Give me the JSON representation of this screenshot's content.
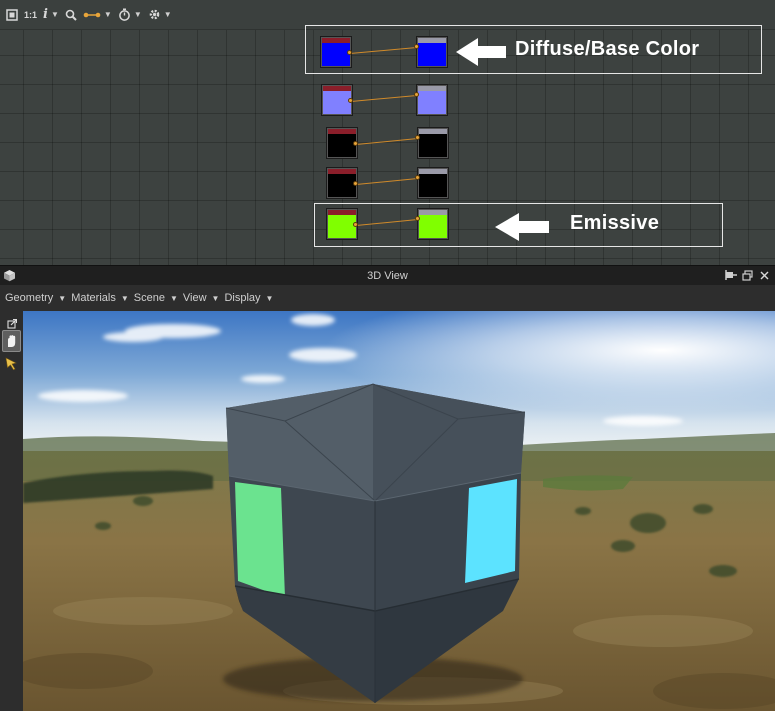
{
  "node_editor": {
    "toolbar": [
      {
        "name": "fit-view-icon",
        "glyph": "▦",
        "dropdown": false
      },
      {
        "name": "one-to-one",
        "label": "1:1",
        "dropdown": false
      },
      {
        "name": "info-icon",
        "label": "i",
        "dropdown": true
      },
      {
        "name": "zoom-icon",
        "glyph": "🔍",
        "dropdown": false
      },
      {
        "name": "link-icon",
        "glyph": "•─•",
        "dropdown": true
      },
      {
        "name": "timer-icon",
        "glyph": "⏱",
        "dropdown": true
      },
      {
        "name": "gear-icon",
        "glyph": "⚙",
        "dropdown": true
      }
    ],
    "node_rows": [
      {
        "color": "#0000ff",
        "header": "#8b1e2a"
      },
      {
        "color": "#8080ff",
        "header": "#8b1e2a"
      },
      {
        "color": "#000000",
        "header": "#8b1e2a"
      },
      {
        "color": "#000000",
        "header": "#8b1e2a"
      },
      {
        "color": "#80ff00",
        "header": "#8b1e2a"
      }
    ],
    "annotations": {
      "diffuse": "Diffuse/Base Color",
      "emissive": "Emissive"
    }
  },
  "view_panel": {
    "title": "3D View",
    "menus": [
      "Geometry",
      "Materials",
      "Scene",
      "View",
      "Display"
    ],
    "dropdown_glyph": "▼",
    "window_controls": [
      "pin-icon",
      "restore-icon",
      "close-icon"
    ],
    "side_tools": [
      "popout-icon",
      "camera-orbit-icon",
      "select-arrow-icon"
    ]
  },
  "colors": {
    "accent_wire": "#d08a2a",
    "emissive_green": "#6be38f",
    "emissive_cyan": "#5ce3ff"
  }
}
